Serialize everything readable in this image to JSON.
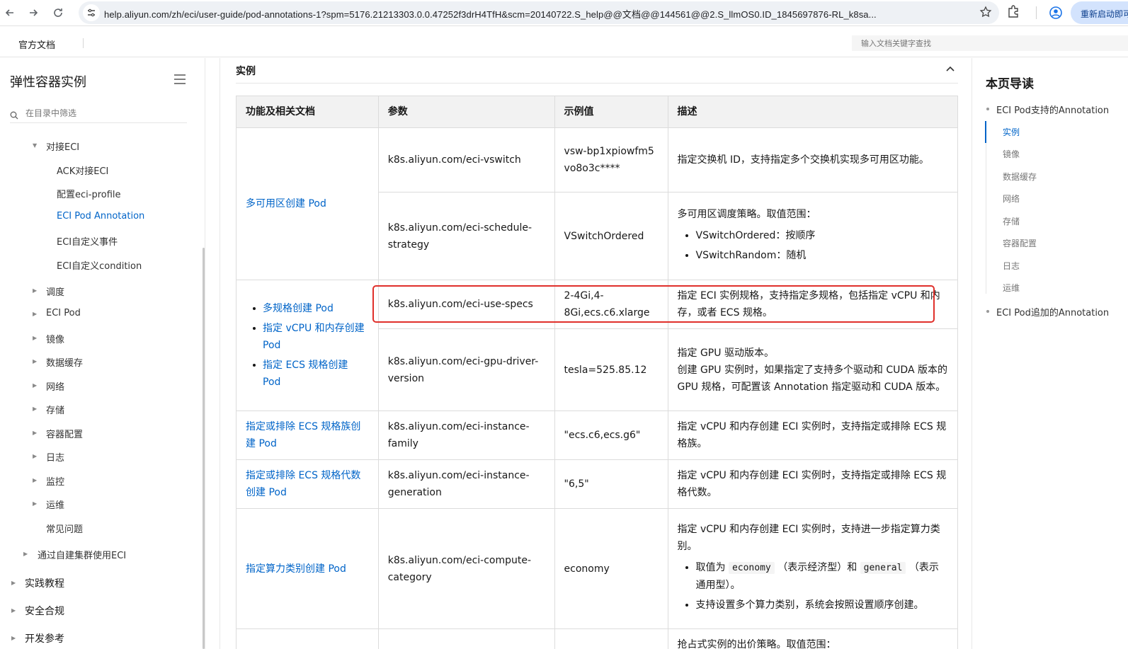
{
  "browser": {
    "url": "help.aliyun.com/zh/eci/user-guide/pod-annotations-1?spm=5176.21213303.0.0.47252f3drH4TfH&scm=20140722.S_help@@文档@@144561@@2.S_llmOS0.ID_1845697876-RL_k8sa...",
    "relaunch_label": "重新启动即可"
  },
  "header": {
    "docs_label": "官方文档",
    "search_placeholder": "输入文档关键字查找"
  },
  "sidebar": {
    "title": "弹性容器实例",
    "filter_placeholder": "在目录中筛选",
    "group_label": "对接ECI",
    "sub_items": [
      "ACK对接ECI",
      "配置eci-profile",
      "ECI Pod Annotation",
      "ECI自定义事件",
      "ECI自定义condition"
    ],
    "items": [
      "调度",
      "ECI Pod",
      "镜像",
      "数据缓存",
      "网络",
      "存储",
      "容器配置",
      "日志",
      "监控",
      "运维"
    ],
    "faq_label": "常见问题",
    "self_built_label": "通过自建集群使用ECI",
    "top_items": [
      "实践教程",
      "安全合规",
      "开发参考"
    ]
  },
  "section": {
    "title": "实例"
  },
  "table": {
    "headers": [
      "功能及相关文档",
      "参数",
      "示例值",
      "描述"
    ],
    "row_multi_az": {
      "func": "多可用区创建 Pod",
      "r1": {
        "param": "k8s.aliyun.com/eci-vswitch",
        "example": "vsw-bp1xpiowfm5vo8o3c****",
        "desc": "指定交换机 ID，支持指定多个交换机实现多可用区功能。"
      },
      "r2": {
        "param": "k8s.aliyun.com/eci-schedule-strategy",
        "example": "VSwitchOrdered",
        "desc_intro": "多可用区调度策略。取值范围：",
        "desc_items": [
          "VSwitchOrdered：按顺序",
          "VSwitchRandom：随机"
        ]
      }
    },
    "row_specs": {
      "funcs": [
        "多规格创建 Pod",
        "指定 vCPU 和内存创建 Pod",
        "指定 ECS 规格创建 Pod"
      ],
      "r1": {
        "param": "k8s.aliyun.com/eci-use-specs",
        "example": "2-4Gi,4-8Gi,ecs.c6.xlarge",
        "desc": "指定 ECI 实例规格，支持指定多规格，包括指定 vCPU 和内存，或者 ECS 规格。"
      },
      "r2": {
        "param": "k8s.aliyun.com/eci-gpu-driver-version",
        "example": "tesla=525.85.12",
        "desc_line1": "指定 GPU 驱动版本。",
        "desc_line2": "创建 GPU 实例时，如果指定了支持多个驱动和 CUDA 版本的 GPU 规格，可配置该 Annotation 指定驱动和 CUDA 版本。"
      }
    },
    "row_family": {
      "func": "指定或排除 ECS 规格族创建 Pod",
      "param": "k8s.aliyun.com/eci-instance-family",
      "example": "\"ecs.c6,ecs.g6\"",
      "desc": "指定 vCPU 和内存创建 ECI 实例时，支持指定或排除 ECS 规格族。"
    },
    "row_generation": {
      "func": "指定或排除 ECS 规格代数创建 Pod",
      "param": "k8s.aliyun.com/eci-instance-generation",
      "example": "\"6,5\"",
      "desc": "指定 vCPU 和内存创建 ECI 实例时，支持指定或排除 ECS 规格代数。"
    },
    "row_compute": {
      "func": "指定算力类别创建 Pod",
      "param": "k8s.aliyun.com/eci-compute-category",
      "example": "economy",
      "desc_intro": "指定 vCPU 和内存创建 ECI 实例时，支持进一步指定算力类别。",
      "item1_a": "取值为",
      "item1_code1": "economy",
      "item1_b": "（表示经济型）和",
      "item1_code2": "general",
      "item1_c": "（表示通用型）。",
      "item2": "支持设置多个算力类别，系统会按照设置顺序创建。"
    },
    "row_partial": {
      "desc": "抢占式实例的出价策略。取值范围："
    }
  },
  "toc": {
    "title": "本页导读",
    "l1_a": "ECI Pod支持的Annotation",
    "items": [
      "实例",
      "镜像",
      "数据缓存",
      "网络",
      "存储",
      "容器配置",
      "日志",
      "运维"
    ],
    "l1_b": "ECI Pod追加的Annotation"
  },
  "colors": {
    "link": "#0064c8",
    "highlight": "#e0302b",
    "header_bg": "#f2f2f2"
  }
}
